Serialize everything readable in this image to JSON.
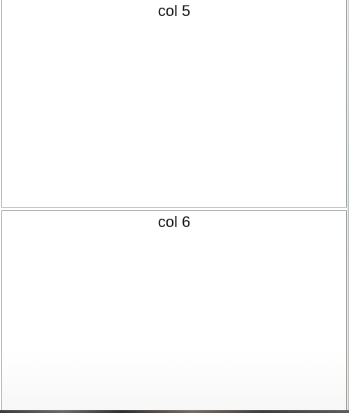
{
  "columns": [
    {
      "label": "col 5"
    },
    {
      "label": "col 6"
    }
  ]
}
